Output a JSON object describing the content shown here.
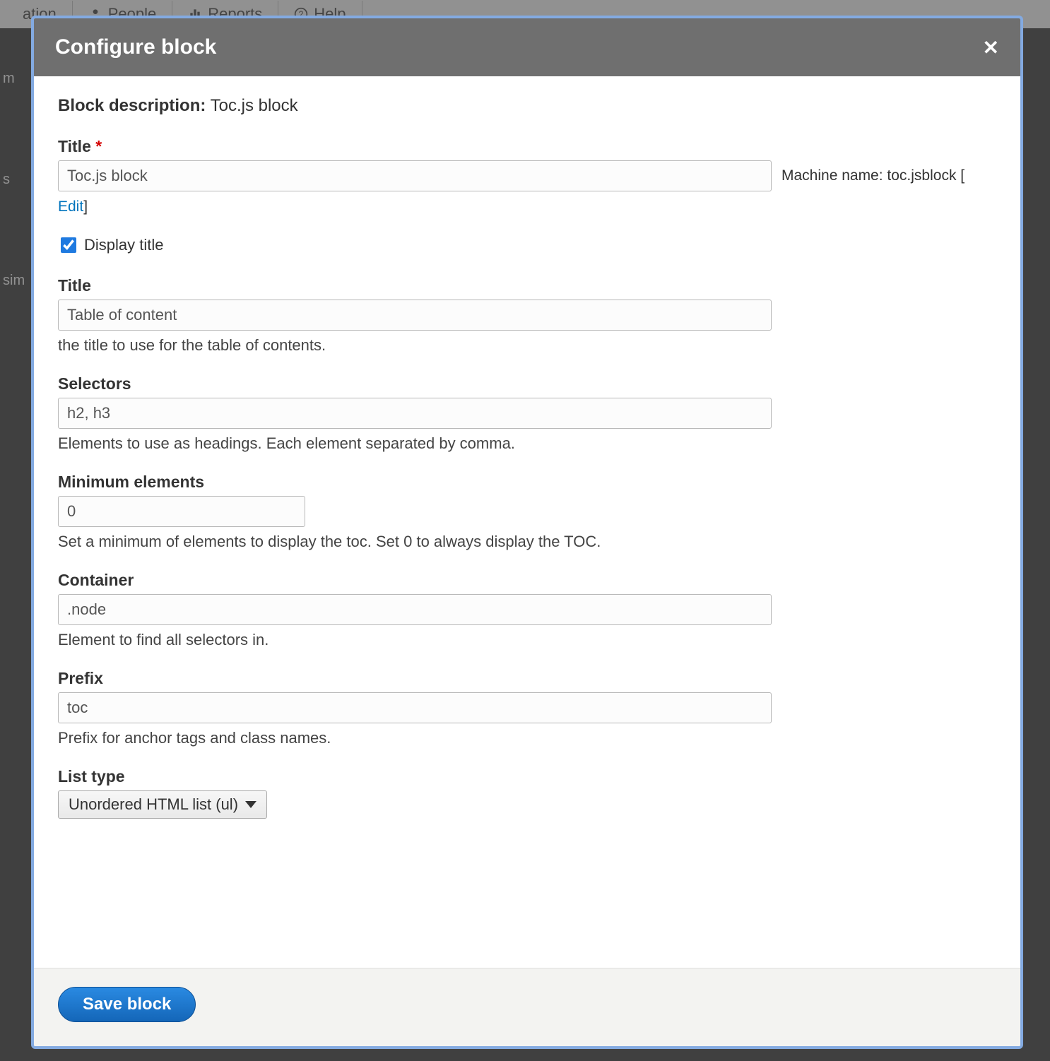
{
  "bg": {
    "tab_people": "People",
    "tab_reports": "Reports",
    "tab_help": "Help",
    "left_frag_ation": "ation",
    "left_frag_m": "m",
    "left_frag_s": "s",
    "left_frag_sim": "sim"
  },
  "dialog": {
    "title": "Configure block",
    "close_glyph": "✕"
  },
  "block_description": {
    "label": "Block description:",
    "value": "Toc.js block"
  },
  "main_title": {
    "label": "Title",
    "required_mark": "*",
    "value": "Toc.js block",
    "machine_prefix": "Machine name:",
    "machine_name": "toc.jsblock [",
    "edit_text": "Edit",
    "edit_suffix": "]"
  },
  "display_title": {
    "label": "Display title",
    "checked": true
  },
  "toc_title": {
    "label": "Title",
    "value": "Table of content",
    "desc": "the title to use for the table of contents."
  },
  "selectors": {
    "label": "Selectors",
    "value": "h2, h3",
    "desc": "Elements to use as headings. Each element separated by comma."
  },
  "min_elements": {
    "label": "Minimum elements",
    "value": "0",
    "desc": "Set a minimum of elements to display the toc. Set 0 to always display the TOC."
  },
  "container": {
    "label": "Container",
    "value": ".node",
    "desc": "Element to find all selectors in."
  },
  "prefix": {
    "label": "Prefix",
    "value": "toc",
    "desc": "Prefix for anchor tags and class names."
  },
  "list_type": {
    "label": "List type",
    "value": "Unordered HTML list (ul)"
  },
  "footer": {
    "save": "Save block"
  }
}
